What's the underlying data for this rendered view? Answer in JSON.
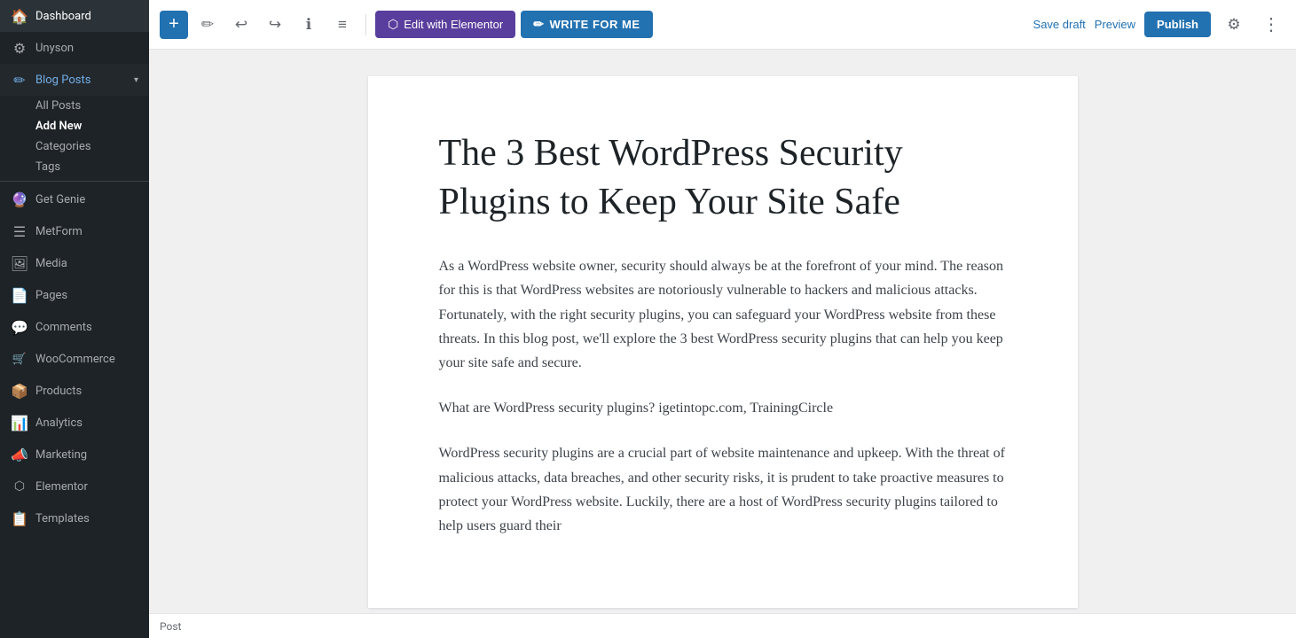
{
  "sidebar": {
    "items": [
      {
        "id": "dashboard",
        "label": "Dashboard",
        "icon": "🏠"
      },
      {
        "id": "unyson",
        "label": "Unyson",
        "icon": "⚙"
      },
      {
        "id": "blog-posts",
        "label": "Blog Posts",
        "icon": "✏",
        "active": true,
        "expanded": true
      },
      {
        "id": "get-genie",
        "label": "Get Genie",
        "icon": "🔮"
      },
      {
        "id": "metform",
        "label": "MetForm",
        "icon": "☰"
      },
      {
        "id": "media",
        "label": "Media",
        "icon": "🖼"
      },
      {
        "id": "pages",
        "label": "Pages",
        "icon": "📄"
      },
      {
        "id": "comments",
        "label": "Comments",
        "icon": "💬"
      },
      {
        "id": "woocommerce",
        "label": "WooCommerce",
        "icon": "🛒"
      },
      {
        "id": "products",
        "label": "Products",
        "icon": "📦"
      },
      {
        "id": "analytics",
        "label": "Analytics",
        "icon": "📊"
      },
      {
        "id": "marketing",
        "label": "Marketing",
        "icon": "📣"
      },
      {
        "id": "elementor",
        "label": "Elementor",
        "icon": "⬡"
      },
      {
        "id": "templates",
        "label": "Templates",
        "icon": "📋"
      }
    ],
    "blog_posts_sub": [
      {
        "id": "all-posts",
        "label": "All Posts"
      },
      {
        "id": "add-new",
        "label": "Add New",
        "active": true
      },
      {
        "id": "categories",
        "label": "Categories"
      },
      {
        "id": "tags",
        "label": "Tags"
      }
    ]
  },
  "toolbar": {
    "add_label": "+",
    "edit_icon": "✏",
    "undo_icon": "↩",
    "redo_icon": "↪",
    "info_icon": "ℹ",
    "tools_icon": "≡",
    "edit_elementor_label": "Edit with Elementor",
    "write_for_me_label": "WRITE FOR ME",
    "save_draft_label": "Save draft",
    "preview_label": "Preview",
    "publish_label": "Publish",
    "settings_icon": "⚙",
    "more_icon": "⋮"
  },
  "post": {
    "title": "The 3 Best WordPress Security Plugins to Keep Your Site Safe",
    "paragraph1": "As a WordPress website owner, security should always be at the forefront of your mind. The reason for this is that WordPress websites are notoriously vulnerable to hackers and malicious attacks. Fortunately, with the right security plugins, you can safeguard your WordPress website from these threats. In this blog post, we'll explore the 3 best WordPress security plugins that can help you keep your site safe and secure.",
    "subheading": "What are WordPress security plugins? igetintopc.com, TrainingCircle",
    "paragraph2": "WordPress security plugins are a crucial part of website maintenance and upkeep. With the threat of malicious attacks, data breaches, and other security risks, it is prudent to take proactive measures to protect your WordPress website. Luckily, there are a host of WordPress security plugins tailored to help users guard their"
  },
  "bottom_bar": {
    "label": "Post"
  },
  "colors": {
    "sidebar_bg": "#1d2327",
    "active_blue": "#2271b1",
    "elementor_purple": "#5a3e9d"
  }
}
